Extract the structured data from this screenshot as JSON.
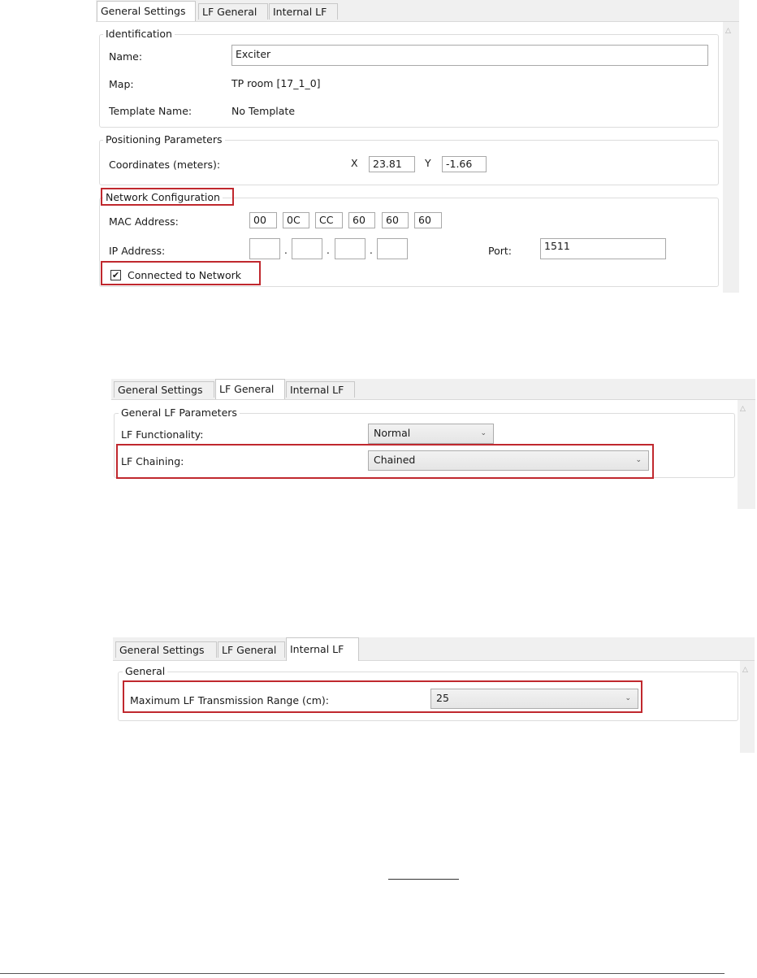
{
  "panel1": {
    "tabs": [
      "General Settings",
      "LF General",
      "Internal LF"
    ],
    "identification": {
      "legend": "Identification",
      "name_label": "Name:",
      "name_value": "Exciter",
      "map_label": "Map:",
      "map_value": "TP room [17_1_0]",
      "template_label": "Template Name:",
      "template_value": "No Template"
    },
    "positioning": {
      "legend": "Positioning Parameters",
      "coords_label": "Coordinates (meters):",
      "x_label": "X",
      "x_value": "23.81",
      "y_label": "Y",
      "y_value": "-1.66"
    },
    "network": {
      "legend": "Network Configuration",
      "mac_label": "MAC Address:",
      "mac": [
        "00",
        "0C",
        "CC",
        "60",
        "60",
        "60"
      ],
      "ip_label": "IP Address:",
      "ip": [
        "",
        "",
        "",
        ""
      ],
      "port_label": "Port:",
      "port_value": "1511",
      "connected_label": "Connected to Network",
      "connected_checked": true
    }
  },
  "panel2": {
    "tabs": [
      "General Settings",
      "LF General",
      "Internal LF"
    ],
    "legend": "General LF Parameters",
    "functionality_label": "LF Functionality:",
    "functionality_value": "Normal",
    "chaining_label": "LF Chaining:",
    "chaining_value": "Chained"
  },
  "panel3": {
    "tabs": [
      "General Settings",
      "LF General",
      "Internal LF"
    ],
    "legend": "General",
    "range_label": "Maximum LF Transmission Range (cm):",
    "range_value": "25"
  },
  "icons": {
    "dropdown": "chevron-down-icon",
    "scroll": "scroll-up-arrow-icon",
    "check": "checkmark-icon"
  },
  "colors": {
    "highlight": "#c0282e",
    "tab_bg": "#f0f0f0",
    "border": "#dcdcdc"
  }
}
